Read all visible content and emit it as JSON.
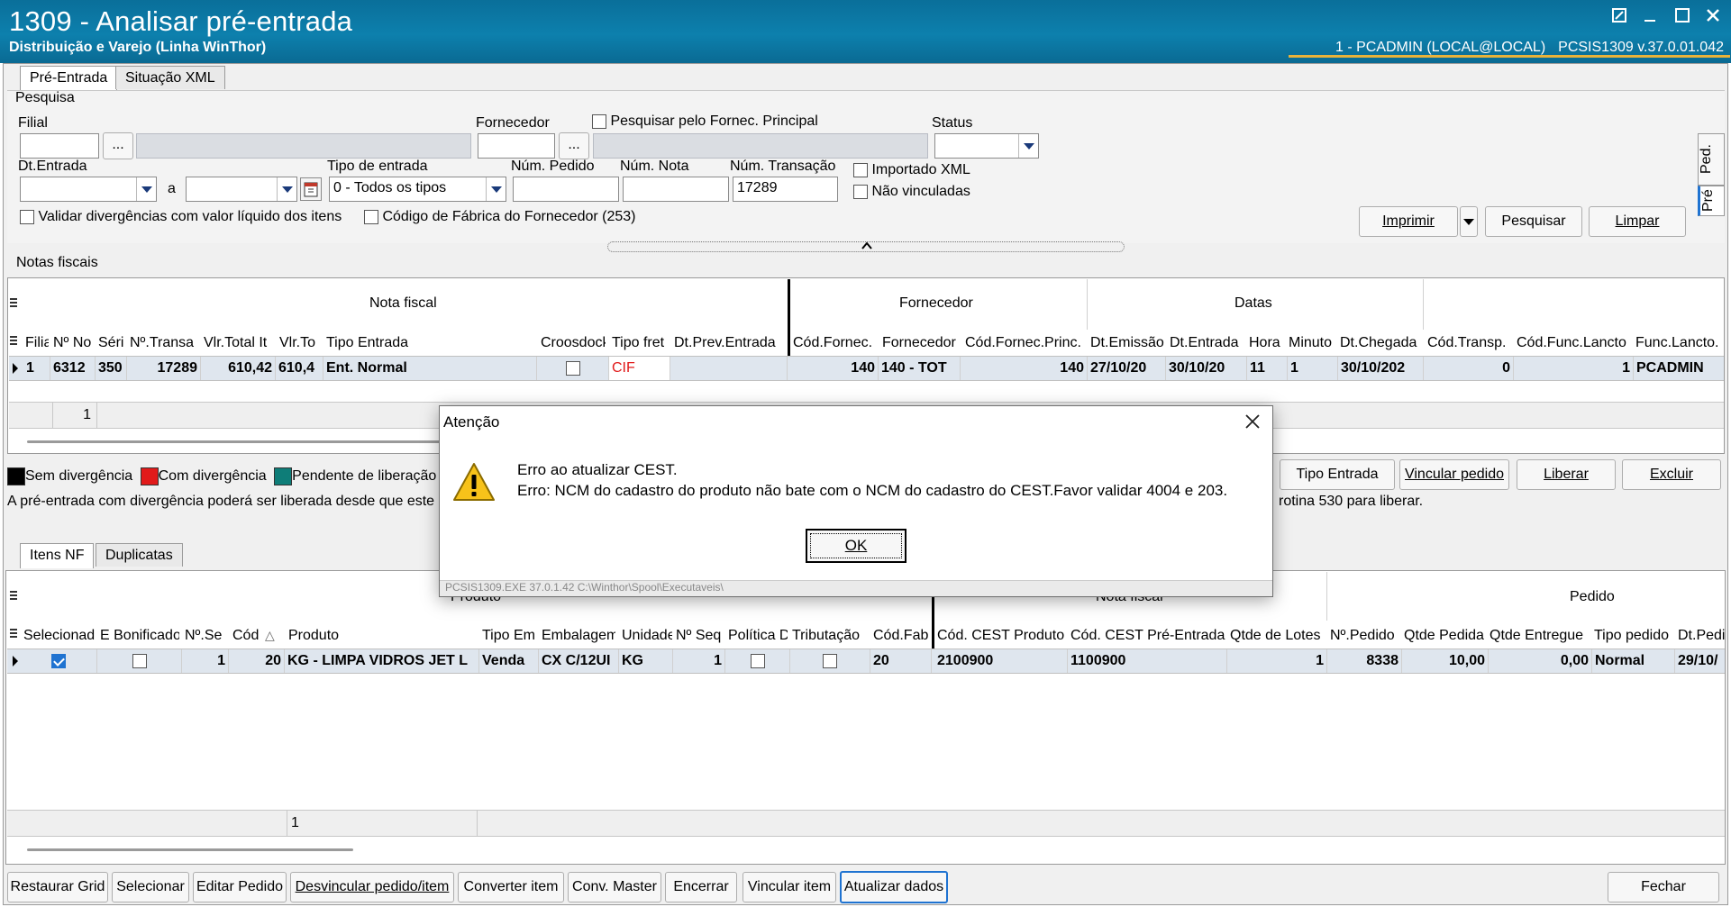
{
  "window": {
    "title": "1309 - Analisar pré-entrada",
    "subtitle": "Distribuição e Varejo (Linha WinThor)",
    "session": "1 - PCADMIN (LOCAL@LOCAL)",
    "version": "PCSIS1309  v.37.0.01.042"
  },
  "tabs": [
    "Pré-Entrada",
    "Situação XML"
  ],
  "pesquisa": {
    "title": "Pesquisa",
    "filial_label": "Filial",
    "filial_value": "",
    "fornecedor_label": "Fornecedor",
    "fornecedor_value": "",
    "principal_label": "Pesquisar pelo Fornec. Principal",
    "status_label": "Status",
    "status_value": "",
    "dtentrada_label": "Dt.Entrada",
    "a_label": "a",
    "tipo_entrada_label": "Tipo de entrada",
    "tipo_entrada_value": "0 - Todos os tipos",
    "num_pedido_label": "Núm. Pedido",
    "num_pedido_value": "",
    "num_nota_label": "Núm. Nota",
    "num_nota_value": "",
    "num_transacao_label": "Núm. Transação",
    "num_transacao_value": "17289",
    "importado_xml": "Importado XML",
    "nao_vinculadas": "Não vinculadas",
    "validar_label": "Validar divergências com valor líquido dos itens",
    "codigo_fabrica_label": "Código de Fábrica do Fornecedor (253)",
    "buttons": {
      "imprimir": "Imprimir",
      "pesquisar": "Pesquisar",
      "limpar": "Limpar"
    },
    "ellipsis": "...",
    "side_tabs": [
      "Ped.",
      "Pré"
    ]
  },
  "notas": {
    "title": "Notas fiscais",
    "groups": [
      "Nota fiscal",
      "Fornecedor",
      "Datas"
    ],
    "columns": [
      "Filia",
      "Nº No",
      "Séri",
      "Nº.Transa",
      "Vlr.Total It",
      "Vlr.To",
      "Tipo Entrada",
      "Croosdock",
      "Tipo fret",
      "Dt.Prev.Entrada",
      "Cód.Fornec.",
      "Fornecedor",
      "Cód.Fornec.Princ.",
      "Dt.Emissão",
      "Dt.Entrada",
      "Hora",
      "Minuto",
      "Dt.Chegada",
      "Cód.Transp.",
      "Cód.Func.Lancto",
      "Func.Lancto."
    ],
    "row": {
      "filial": "1",
      "num": "6312",
      "serie": "350",
      "transacao": "17289",
      "vlr_total": "610,42",
      "vlr_to": "610,4",
      "tipo_entrada": "Ent. Normal",
      "tipo_frete": "CIF",
      "cod_fornec": "140",
      "fornecedor": "140 - TOT",
      "cod_princ": "140",
      "dt_emissao": "27/10/20",
      "dt_entrada": "30/10/20",
      "hora": "11",
      "minuto": "1",
      "dt_chegada": "30/10/202",
      "cod_transp": "0",
      "cod_func": "1",
      "func": "PCADMIN"
    },
    "footer_count": "1"
  },
  "legend": {
    "sem": "Sem divergência",
    "com": "Com divergência",
    "pendente": "Pendente de liberação",
    "note_left": "A pré-entrada com divergência poderá ser liberada desde que este",
    "note_right": "rotina 530 para liberar.",
    "colors": {
      "sem": "#000000",
      "com": "#e11a1a",
      "pendente": "#0e7d78"
    }
  },
  "actions": {
    "tipo_entrada": "Tipo Entrada",
    "vincular_pedido": "Vincular pedido",
    "liberar": "Liberar",
    "excluir": "Excluir"
  },
  "item_tabs": [
    "Itens NF",
    "Duplicatas"
  ],
  "itens": {
    "groups": [
      "Produto",
      "Nota fiscal",
      "Pedido"
    ],
    "columns": [
      "Selecionad",
      "E Bonificado",
      "Nº.Se",
      "Cód",
      "Produto",
      "Tipo Em",
      "Embalagem",
      "Unidade",
      "Nº Seq",
      "Política D",
      "Tributação",
      "Cód.Fab",
      "Cód. CEST Produto",
      "Cód. CEST Pré-Entrada",
      "Qtde de Lotes",
      "Nº.Pedido",
      "Qtde Pedida",
      "Qtde Entregue",
      "Tipo pedido",
      "Dt.Pedi"
    ],
    "row": {
      "nseq": "1",
      "cod": "20",
      "produto": "KG - LIMPA VIDROS JET L",
      "tipo": "Venda",
      "embalagem": "CX C/12UI",
      "unidade": "KG",
      "seq": "1",
      "cod_fab": "20",
      "cest_prod": "2100900",
      "cest_pre": "1100900",
      "lotes": "1",
      "pedido": "8338",
      "qtde_pedida": "10,00",
      "qtde_entregue": "0,00",
      "tipo_pedido": "Normal",
      "dt_pedido": "29/10/"
    },
    "footer_count": "1",
    "sort_mark": "△"
  },
  "bottom_buttons": [
    "Restaurar Grid",
    "Selecionar",
    "Editar Pedido",
    "Desvincular pedido/item",
    "Converter item",
    "Conv. Master",
    "Encerrar",
    "Vincular item",
    "Atualizar dados"
  ],
  "fechar": "Fechar",
  "dialog": {
    "title": "Atenção",
    "line1": "Erro ao atualizar CEST.",
    "line2": "Erro: NCM do cadastro do produto não bate com o NCM do cadastro do CEST.Favor validar 4004 e 203.",
    "ok": "OK",
    "status": "PCSIS1309.EXE 37.0.1.42 C:\\Winthor\\Spool\\Executaveis\\"
  }
}
